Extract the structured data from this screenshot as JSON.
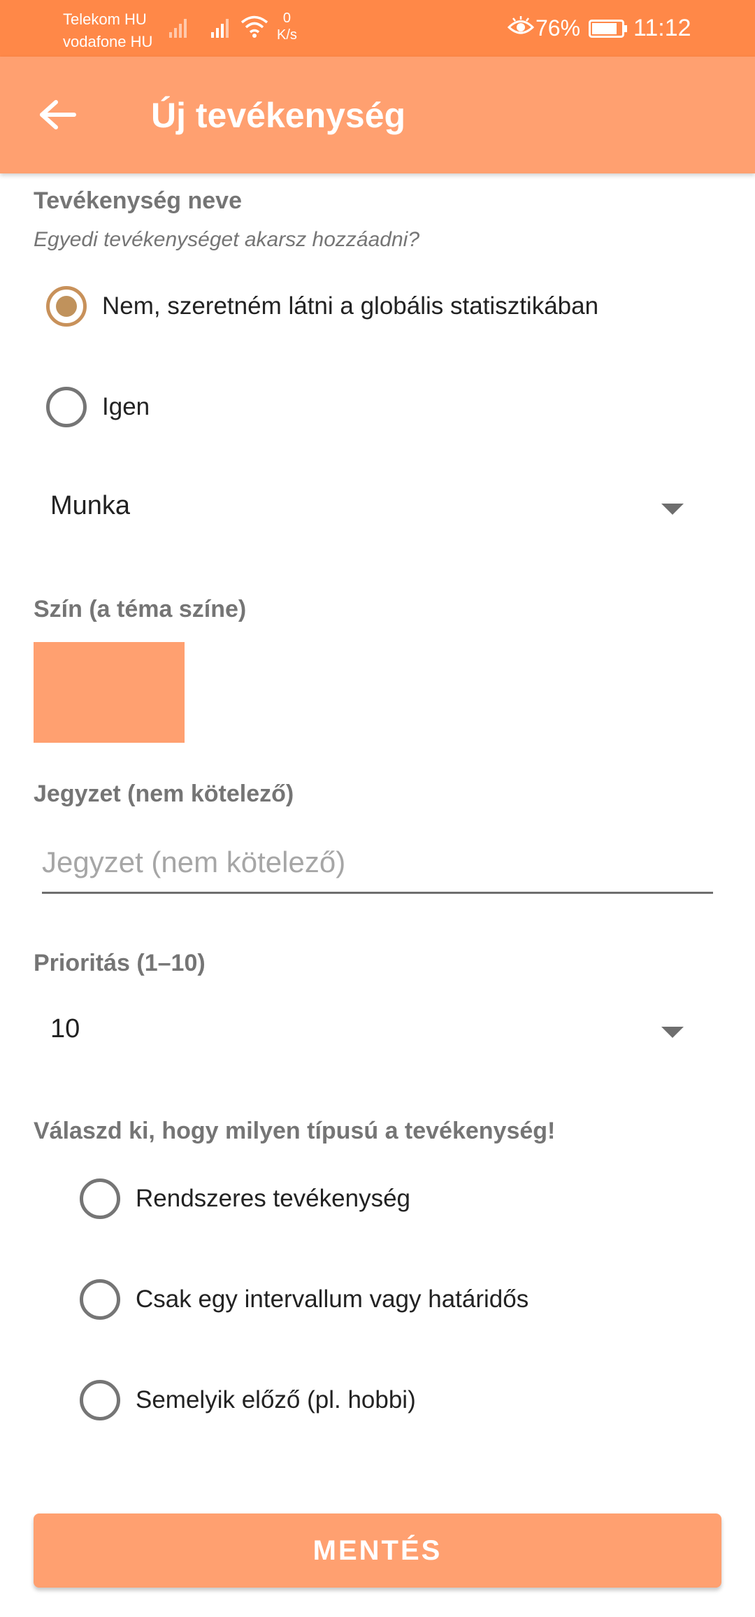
{
  "status_bar": {
    "carrier1": "Telekom HU",
    "carrier2": "vodafone HU",
    "net_speed_value": "0",
    "net_speed_unit": "K/s",
    "battery": "76%",
    "time": "11:12",
    "icons": [
      "signal-icon",
      "signal-icon",
      "wifi-icon",
      "eye-icon",
      "battery-icon"
    ]
  },
  "app_bar": {
    "title": "Új tevékenység",
    "back_icon": "arrow-left-icon"
  },
  "activity_name": {
    "label": "Tevékenység neve",
    "question": "Egyedi tevékenységet akarsz hozzáadni?",
    "options": [
      {
        "label": "Nem, szeretném látni a globális statisztikában",
        "selected": true
      },
      {
        "label": "Igen",
        "selected": false
      }
    ],
    "dropdown_value": "Munka"
  },
  "color": {
    "label": "Szín (a téma színe)",
    "value": "#ffa070"
  },
  "note": {
    "label": "Jegyzet (nem kötelező)",
    "placeholder": "Jegyzet (nem kötelező)",
    "value": ""
  },
  "priority": {
    "label": "Prioritás (1–10)",
    "value": "10"
  },
  "type": {
    "label": "Válaszd ki, hogy milyen típusú a tevékenység!",
    "options": [
      {
        "label": "Rendszeres tevékenység",
        "selected": false
      },
      {
        "label": "Csak egy intervallum vagy határidős",
        "selected": false
      },
      {
        "label": "Semelyik előző (pl. hobbi)",
        "selected": false
      }
    ]
  },
  "save_button": {
    "label": "MENTÉS"
  },
  "colors": {
    "status_bar": "#ff8848",
    "app_bar": "#ffa070",
    "accent": "#c0925c"
  }
}
